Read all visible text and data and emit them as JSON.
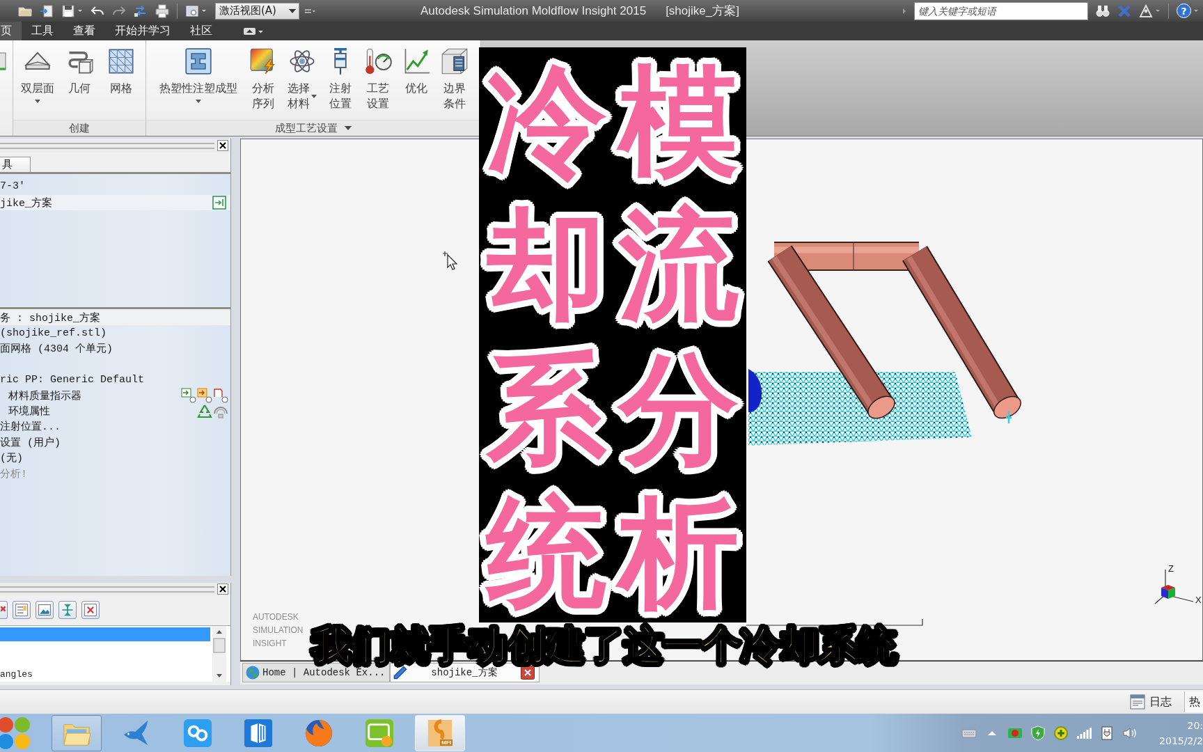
{
  "title_bar": {
    "view_dropdown": {
      "value": "激活视图(A)"
    },
    "title": "Autodesk Simulation Moldflow Insight 2015",
    "document": "[shojike_方案]",
    "search": {
      "placeholder": "键入关键字或短语"
    },
    "help": "?"
  },
  "ribbon": {
    "tabs": [
      {
        "label": "页",
        "selected": true
      },
      {
        "label": "工具",
        "selected": false
      },
      {
        "label": "查看",
        "selected": false
      },
      {
        "label": "开始并学习",
        "selected": false
      },
      {
        "label": "社区",
        "selected": false
      }
    ],
    "groups": [
      {
        "label": "创建",
        "dropdown": false,
        "buttons": [
          {
            "label": "双层面",
            "dropdown": true
          },
          {
            "label": "几何",
            "dropdown": false
          },
          {
            "label": "网格",
            "dropdown": false
          }
        ]
      },
      {
        "label": "成型工艺设置",
        "dropdown": true,
        "buttons": [
          {
            "label": "热塑性注塑成型",
            "dropdown": true
          },
          {
            "label": "分析序列",
            "dropdown": false
          },
          {
            "label": "选择材料",
            "dropdown": true
          },
          {
            "label": "注射位置",
            "dropdown": false
          },
          {
            "label": "工艺设置",
            "dropdown": false
          },
          {
            "label": "优化",
            "dropdown": false
          },
          {
            "label": "边界条件",
            "dropdown": false
          }
        ]
      }
    ]
  },
  "project_pane": {
    "tabs": [
      {
        "label": "具",
        "selected": true
      }
    ],
    "items": [
      {
        "label": "7-3'",
        "selected": false
      },
      {
        "label": "jike_方案",
        "selected": true
      }
    ]
  },
  "task_pane": {
    "items": [
      {
        "label": "务 : shojike_方案",
        "selected": true,
        "disabled": false
      },
      {
        "label": "(shojike_ref.stl)",
        "selected": false,
        "disabled": false
      },
      {
        "label": "面网格 (4304 个单元)",
        "selected": false,
        "disabled": false
      },
      {
        "label": "ric PP: Generic Default",
        "selected": false,
        "disabled": false,
        "children": [
          {
            "label": "材料质量指示器",
            "selected": false,
            "disabled": false
          },
          {
            "label": "环境属性",
            "selected": false,
            "disabled": false
          }
        ]
      },
      {
        "label": "注射位置...",
        "selected": false,
        "disabled": false
      },
      {
        "label": "设置 (用户)",
        "selected": false,
        "disabled": false
      },
      {
        "label": "(无)",
        "selected": false,
        "disabled": false
      },
      {
        "label": "分析!",
        "selected": false,
        "disabled": true
      }
    ]
  },
  "layer_pane": {
    "rows": [
      {
        "selected": true
      },
      {
        "label": "angles",
        "selected": false
      }
    ]
  },
  "viewport": {
    "logo": [
      "AUTODESK",
      "SIMULATION",
      "INSIGHT"
    ],
    "axes": [
      "Z",
      "X"
    ]
  },
  "document_tabs": [
    {
      "label": "Home | Autodesk Ex...",
      "selected": false
    },
    {
      "label": "shojike_方案",
      "selected": true
    }
  ],
  "status_bar": {
    "log": "日志",
    "panel_tab": "热"
  },
  "taskbar": {
    "apps": [
      {
        "open": true,
        "selected": false
      },
      {
        "open": false,
        "selected": false
      },
      {
        "open": false,
        "selected": false
      },
      {
        "open": false,
        "selected": false
      },
      {
        "open": false,
        "selected": false
      },
      {
        "open": false,
        "selected": false
      },
      {
        "open": true,
        "selected": true,
        "label": "MFI"
      }
    ],
    "clock": {
      "time": "20:",
      "date": "2015/2/2"
    }
  },
  "overlay": {
    "title_columns": [
      "冷却系统",
      "模流分析"
    ],
    "subtitle": "我们就手动创建了这一个冷却系统"
  }
}
